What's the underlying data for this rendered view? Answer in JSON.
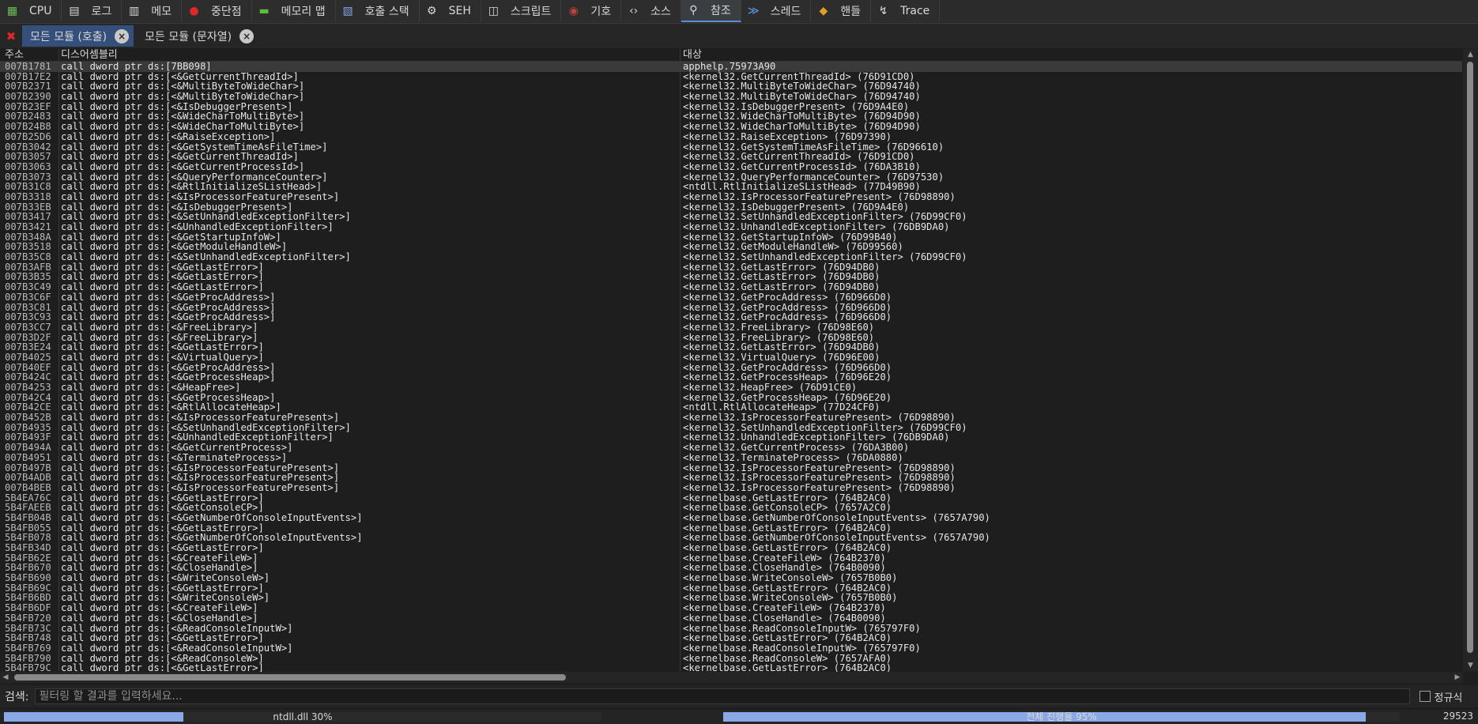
{
  "tabs": [
    {
      "label": "CPU",
      "icon": "cpu-icon"
    },
    {
      "label": "로그",
      "icon": "log-icon"
    },
    {
      "label": "메모",
      "icon": "notes-icon"
    },
    {
      "label": "중단점",
      "icon": "breakpoint-icon"
    },
    {
      "label": "메모리 맵",
      "icon": "memory-map-icon"
    },
    {
      "label": "호출 스택",
      "icon": "call-stack-icon"
    },
    {
      "label": "SEH",
      "icon": "seh-icon"
    },
    {
      "label": "스크립트",
      "icon": "script-icon"
    },
    {
      "label": "기호",
      "icon": "symbols-icon"
    },
    {
      "label": "소스",
      "icon": "source-icon"
    },
    {
      "label": "참조",
      "icon": "references-icon",
      "active": true
    },
    {
      "label": "스레드",
      "icon": "threads-icon"
    },
    {
      "label": "핸들",
      "icon": "handles-icon"
    },
    {
      "label": "Trace",
      "icon": "trace-icon"
    }
  ],
  "subtabs": [
    {
      "label": "모든 모듈 (호출)",
      "active": true
    },
    {
      "label": "모든 모듈 (문자열)",
      "active": false
    }
  ],
  "columns": {
    "address": "주소",
    "disassembly": "디스어셈블리",
    "target": "대상"
  },
  "rows": [
    [
      "007B1781",
      "call dword ptr ds:[7BB098]",
      "apphelp.75973A90"
    ],
    [
      "007B17E2",
      "call dword ptr ds:[<&GetCurrentThreadId>]",
      "<kernel32.GetCurrentThreadId> (76D91CD0)"
    ],
    [
      "007B2371",
      "call dword ptr ds:[<&MultiByteToWideChar>]",
      "<kernel32.MultiByteToWideChar> (76D94740)"
    ],
    [
      "007B2390",
      "call dword ptr ds:[<&MultiByteToWideChar>]",
      "<kernel32.MultiByteToWideChar> (76D94740)"
    ],
    [
      "007B23EF",
      "call dword ptr ds:[<&IsDebuggerPresent>]",
      "<kernel32.IsDebuggerPresent> (76D9A4E0)"
    ],
    [
      "007B2483",
      "call dword ptr ds:[<&WideCharToMultiByte>]",
      "<kernel32.WideCharToMultiByte> (76D94D90)"
    ],
    [
      "007B24B8",
      "call dword ptr ds:[<&WideCharToMultiByte>]",
      "<kernel32.WideCharToMultiByte> (76D94D90)"
    ],
    [
      "007B25D6",
      "call dword ptr ds:[<&RaiseException>]",
      "<kernel32.RaiseException> (76D97390)"
    ],
    [
      "007B3042",
      "call dword ptr ds:[<&GetSystemTimeAsFileTime>]",
      "<kernel32.GetSystemTimeAsFileTime> (76D96610)"
    ],
    [
      "007B3057",
      "call dword ptr ds:[<&GetCurrentThreadId>]",
      "<kernel32.GetCurrentThreadId> (76D91CD0)"
    ],
    [
      "007B3063",
      "call dword ptr ds:[<&GetCurrentProcessId>]",
      "<kernel32.GetCurrentProcessId> (76DA3B10)"
    ],
    [
      "007B3073",
      "call dword ptr ds:[<&QueryPerformanceCounter>]",
      "<kernel32.QueryPerformanceCounter> (76D97530)"
    ],
    [
      "007B31C8",
      "call dword ptr ds:[<&RtlInitializeSListHead>]",
      "<ntdll.RtlInitializeSListHead> (77D49B90)"
    ],
    [
      "007B3318",
      "call dword ptr ds:[<&IsProcessorFeaturePresent>]",
      "<kernel32.IsProcessorFeaturePresent> (76D98890)"
    ],
    [
      "007B33EB",
      "call dword ptr ds:[<&IsDebuggerPresent>]",
      "<kernel32.IsDebuggerPresent> (76D9A4E0)"
    ],
    [
      "007B3417",
      "call dword ptr ds:[<&SetUnhandledExceptionFilter>]",
      "<kernel32.SetUnhandledExceptionFilter> (76D99CF0)"
    ],
    [
      "007B3421",
      "call dword ptr ds:[<&UnhandledExceptionFilter>]",
      "<kernel32.UnhandledExceptionFilter> (76DB9DA0)"
    ],
    [
      "007B348A",
      "call dword ptr ds:[<&GetStartupInfoW>]",
      "<kernel32.GetStartupInfoW> (76D99B40)"
    ],
    [
      "007B3518",
      "call dword ptr ds:[<&GetModuleHandleW>]",
      "<kernel32.GetModuleHandleW> (76D99560)"
    ],
    [
      "007B35C8",
      "call dword ptr ds:[<&SetUnhandledExceptionFilter>]",
      "<kernel32.SetUnhandledExceptionFilter> (76D99CF0)"
    ],
    [
      "007B3AFB",
      "call dword ptr ds:[<&GetLastError>]",
      "<kernel32.GetLastError> (76D94DB0)"
    ],
    [
      "007B3B35",
      "call dword ptr ds:[<&GetLastError>]",
      "<kernel32.GetLastError> (76D94DB0)"
    ],
    [
      "007B3C49",
      "call dword ptr ds:[<&GetLastError>]",
      "<kernel32.GetLastError> (76D94DB0)"
    ],
    [
      "007B3C6F",
      "call dword ptr ds:[<&GetProcAddress>]",
      "<kernel32.GetProcAddress> (76D966D0)"
    ],
    [
      "007B3C81",
      "call dword ptr ds:[<&GetProcAddress>]",
      "<kernel32.GetProcAddress> (76D966D0)"
    ],
    [
      "007B3C93",
      "call dword ptr ds:[<&GetProcAddress>]",
      "<kernel32.GetProcAddress> (76D966D0)"
    ],
    [
      "007B3CC7",
      "call dword ptr ds:[<&FreeLibrary>]",
      "<kernel32.FreeLibrary> (76D98E60)"
    ],
    [
      "007B3D2F",
      "call dword ptr ds:[<&FreeLibrary>]",
      "<kernel32.FreeLibrary> (76D98E60)"
    ],
    [
      "007B3E24",
      "call dword ptr ds:[<&GetLastError>]",
      "<kernel32.GetLastError> (76D94DB0)"
    ],
    [
      "007B4025",
      "call dword ptr ds:[<&VirtualQuery>]",
      "<kernel32.VirtualQuery> (76D96E00)"
    ],
    [
      "007B40EF",
      "call dword ptr ds:[<&GetProcAddress>]",
      "<kernel32.GetProcAddress> (76D966D0)"
    ],
    [
      "007B424C",
      "call dword ptr ds:[<&GetProcessHeap>]",
      "<kernel32.GetProcessHeap> (76D96E20)"
    ],
    [
      "007B4253",
      "call dword ptr ds:[<&HeapFree>]",
      "<kernel32.HeapFree> (76D91CE0)"
    ],
    [
      "007B42C4",
      "call dword ptr ds:[<&GetProcessHeap>]",
      "<kernel32.GetProcessHeap> (76D96E20)"
    ],
    [
      "007B42CE",
      "call dword ptr ds:[<&RtlAllocateHeap>]",
      "<ntdll.RtlAllocateHeap> (77D24CF0)"
    ],
    [
      "007B452B",
      "call dword ptr ds:[<&IsProcessorFeaturePresent>]",
      "<kernel32.IsProcessorFeaturePresent> (76D98890)"
    ],
    [
      "007B4935",
      "call dword ptr ds:[<&SetUnhandledExceptionFilter>]",
      "<kernel32.SetUnhandledExceptionFilter> (76D99CF0)"
    ],
    [
      "007B493F",
      "call dword ptr ds:[<&UnhandledExceptionFilter>]",
      "<kernel32.UnhandledExceptionFilter> (76DB9DA0)"
    ],
    [
      "007B494A",
      "call dword ptr ds:[<&GetCurrentProcess>]",
      "<kernel32.GetCurrentProcess> (76DA3B00)"
    ],
    [
      "007B4951",
      "call dword ptr ds:[<&TerminateProcess>]",
      "<kernel32.TerminateProcess> (76DA0880)"
    ],
    [
      "007B497B",
      "call dword ptr ds:[<&IsProcessorFeaturePresent>]",
      "<kernel32.IsProcessorFeaturePresent> (76D98890)"
    ],
    [
      "007B4ADB",
      "call dword ptr ds:[<&IsProcessorFeaturePresent>]",
      "<kernel32.IsProcessorFeaturePresent> (76D98890)"
    ],
    [
      "007B4BEB",
      "call dword ptr ds:[<&IsProcessorFeaturePresent>]",
      "<kernel32.IsProcessorFeaturePresent> (76D98890)"
    ],
    [
      "5B4EA76C",
      "call dword ptr ds:[<&GetLastError>]",
      "<kernelbase.GetLastError> (764B2AC0)"
    ],
    [
      "5B4FAEEB",
      "call dword ptr ds:[<&GetConsoleCP>]",
      "<kernelbase.GetConsoleCP> (7657A2C0)"
    ],
    [
      "5B4FB04B",
      "call dword ptr ds:[<&GetNumberOfConsoleInputEvents>]",
      "<kernelbase.GetNumberOfConsoleInputEvents> (7657A790)"
    ],
    [
      "5B4FB055",
      "call dword ptr ds:[<&GetLastError>]",
      "<kernelbase.GetLastError> (764B2AC0)"
    ],
    [
      "5B4FB078",
      "call dword ptr ds:[<&GetNumberOfConsoleInputEvents>]",
      "<kernelbase.GetNumberOfConsoleInputEvents> (7657A790)"
    ],
    [
      "5B4FB34D",
      "call dword ptr ds:[<&GetLastError>]",
      "<kernelbase.GetLastError> (764B2AC0)"
    ],
    [
      "5B4FB62E",
      "call dword ptr ds:[<&CreateFileW>]",
      "<kernelbase.CreateFileW> (764B2370)"
    ],
    [
      "5B4FB670",
      "call dword ptr ds:[<&CloseHandle>]",
      "<kernelbase.CloseHandle> (764B0090)"
    ],
    [
      "5B4FB690",
      "call dword ptr ds:[<&WriteConsoleW>]",
      "<kernelbase.WriteConsoleW> (7657B0B0)"
    ],
    [
      "5B4FB69C",
      "call dword ptr ds:[<&GetLastError>]",
      "<kernelbase.GetLastError> (764B2AC0)"
    ],
    [
      "5B4FB6BD",
      "call dword ptr ds:[<&WriteConsoleW>]",
      "<kernelbase.WriteConsoleW> (7657B0B0)"
    ],
    [
      "5B4FB6DF",
      "call dword ptr ds:[<&CreateFileW>]",
      "<kernelbase.CreateFileW> (764B2370)"
    ],
    [
      "5B4FB720",
      "call dword ptr ds:[<&CloseHandle>]",
      "<kernelbase.CloseHandle> (764B0090)"
    ],
    [
      "5B4FB73C",
      "call dword ptr ds:[<&ReadConsoleInputW>]",
      "<kernelbase.ReadConsoleInputW> (765797F0)"
    ],
    [
      "5B4FB748",
      "call dword ptr ds:[<&GetLastError>]",
      "<kernelbase.GetLastError> (764B2AC0)"
    ],
    [
      "5B4FB769",
      "call dword ptr ds:[<&ReadConsoleInputW>]",
      "<kernelbase.ReadConsoleInputW> (765797F0)"
    ],
    [
      "5B4FB790",
      "call dword ptr ds:[<&ReadConsoleW>]",
      "<kernelbase.ReadConsoleW> (7657AFA0)"
    ],
    [
      "5B4FB79C",
      "call dword ptr ds:[<&GetLastError>]",
      "<kernelbase.GetLastError> (764B2AC0)"
    ]
  ],
  "search": {
    "label": "검색:",
    "placeholder": "필터링 할 결과를 입력하세요...",
    "value": ""
  },
  "regex_label": "정규식",
  "status": {
    "module_progress": {
      "label": "ntdll.dll 30%",
      "fraction": 0.3
    },
    "total_progress": {
      "label": "전체 진행율 95%",
      "fraction": 0.95
    },
    "count": "29523"
  },
  "colors": {
    "accent": "#5a8fd6",
    "selected_tab": "#34507a",
    "progress_fill": "#8aa8e6",
    "close_red": "#e02828"
  }
}
